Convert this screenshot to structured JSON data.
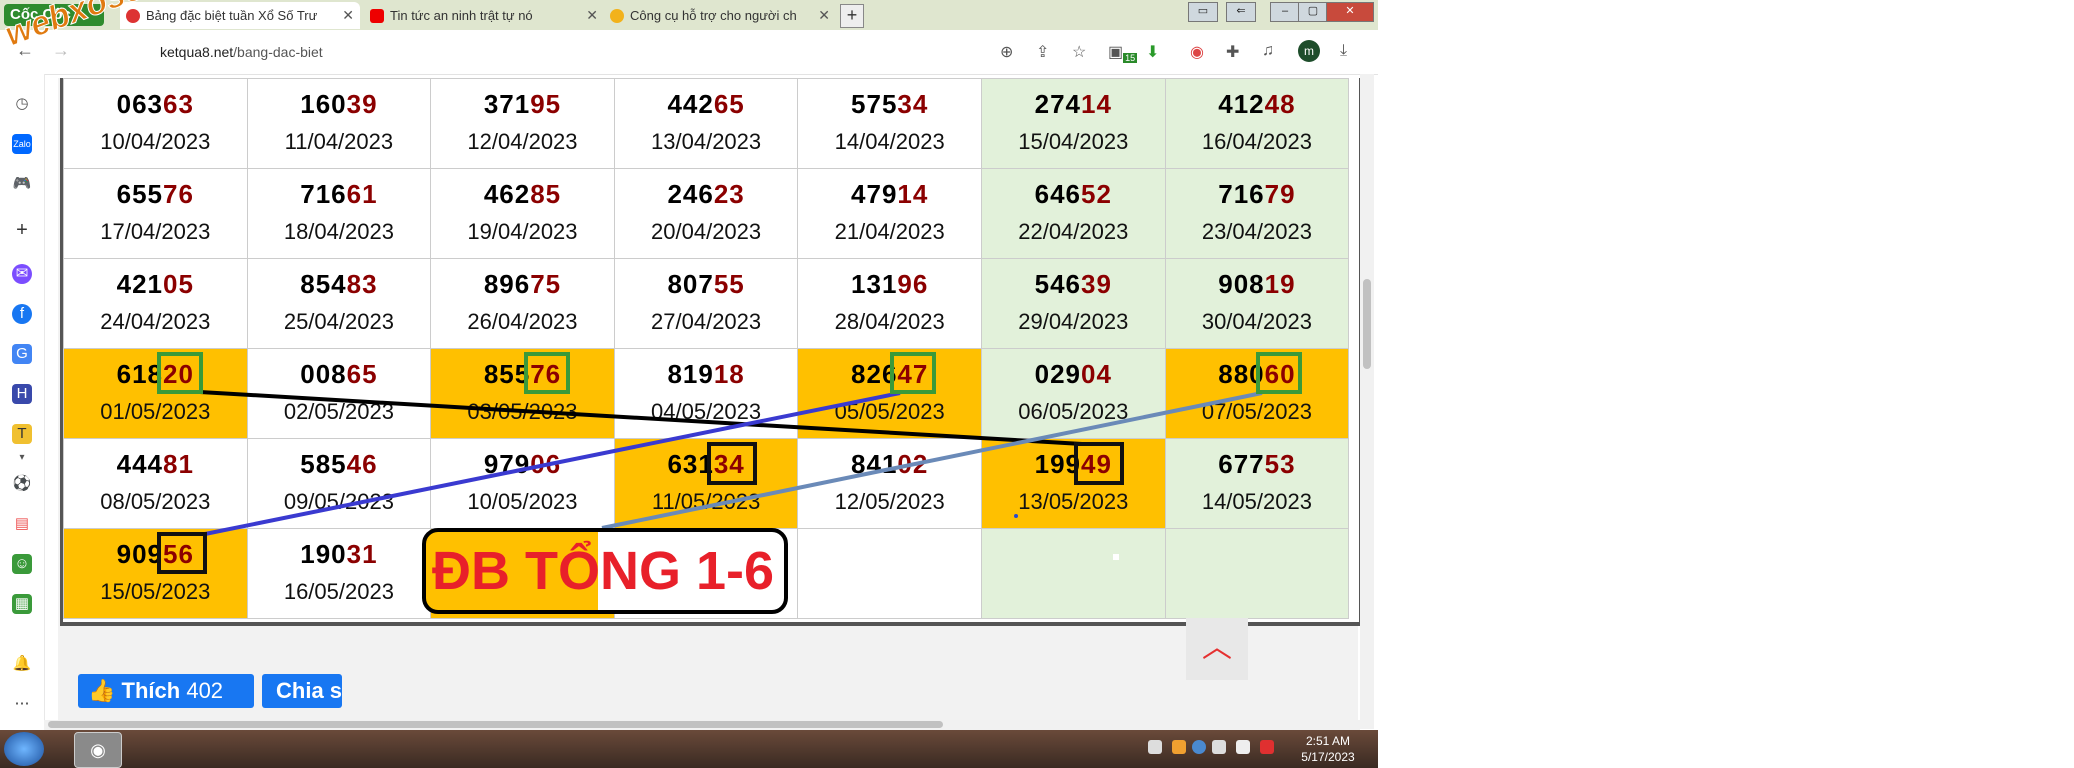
{
  "browser": {
    "brand": "Cốc Cốc",
    "tabs": [
      {
        "label": "Bảng đặc biệt tuần Xổ Số Trư",
        "icon": "coccoc-tab-icon",
        "active": true
      },
      {
        "label": "Tin tức an ninh trật tự nó",
        "icon": "youtube-icon",
        "active": false
      },
      {
        "label": "Công cụ hỗ trợ cho người ch",
        "icon": "xs-icon",
        "active": false
      }
    ],
    "url_host": "ketqua8.net",
    "url_path": "/bang-dac-biet",
    "profile_initial": "m",
    "ext_badge": "15"
  },
  "watermark": "webxoso.net",
  "results": [
    [
      {
        "head": "063",
        "tail": "63",
        "date": "10/04/2023",
        "bg": "white"
      },
      {
        "head": "160",
        "tail": "39",
        "date": "11/04/2023",
        "bg": "white"
      },
      {
        "head": "371",
        "tail": "95",
        "date": "12/04/2023",
        "bg": "white"
      },
      {
        "head": "442",
        "tail": "65",
        "date": "13/04/2023",
        "bg": "white"
      },
      {
        "head": "575",
        "tail": "34",
        "date": "14/04/2023",
        "bg": "white"
      },
      {
        "head": "274",
        "tail": "14",
        "date": "15/04/2023",
        "bg": "green"
      },
      {
        "head": "412",
        "tail": "48",
        "date": "16/04/2023",
        "bg": "green"
      }
    ],
    [
      {
        "head": "655",
        "tail": "76",
        "date": "17/04/2023",
        "bg": "white"
      },
      {
        "head": "716",
        "tail": "61",
        "date": "18/04/2023",
        "bg": "white"
      },
      {
        "head": "462",
        "tail": "85",
        "date": "19/04/2023",
        "bg": "white"
      },
      {
        "head": "246",
        "tail": "23",
        "date": "20/04/2023",
        "bg": "white"
      },
      {
        "head": "479",
        "tail": "14",
        "date": "21/04/2023",
        "bg": "white"
      },
      {
        "head": "646",
        "tail": "52",
        "date": "22/04/2023",
        "bg": "green"
      },
      {
        "head": "716",
        "tail": "79",
        "date": "23/04/2023",
        "bg": "green"
      }
    ],
    [
      {
        "head": "421",
        "tail": "05",
        "date": "24/04/2023",
        "bg": "white"
      },
      {
        "head": "854",
        "tail": "83",
        "date": "25/04/2023",
        "bg": "white"
      },
      {
        "head": "896",
        "tail": "75",
        "date": "26/04/2023",
        "bg": "white"
      },
      {
        "head": "807",
        "tail": "55",
        "date": "27/04/2023",
        "bg": "white"
      },
      {
        "head": "131",
        "tail": "96",
        "date": "28/04/2023",
        "bg": "white"
      },
      {
        "head": "546",
        "tail": "39",
        "date": "29/04/2023",
        "bg": "green"
      },
      {
        "head": "908",
        "tail": "19",
        "date": "30/04/2023",
        "bg": "green"
      }
    ],
    [
      {
        "head": "618",
        "tail": "20",
        "date": "01/05/2023",
        "bg": "yellow"
      },
      {
        "head": "008",
        "tail": "65",
        "date": "02/05/2023",
        "bg": "white"
      },
      {
        "head": "855",
        "tail": "76",
        "date": "03/05/2023",
        "bg": "yellow"
      },
      {
        "head": "819",
        "tail": "18",
        "date": "04/05/2023",
        "bg": "white"
      },
      {
        "head": "826",
        "tail": "47",
        "date": "05/05/2023",
        "bg": "yellow"
      },
      {
        "head": "029",
        "tail": "04",
        "date": "06/05/2023",
        "bg": "green"
      },
      {
        "head": "880",
        "tail": "60",
        "date": "07/05/2023",
        "bg": "yellow"
      }
    ],
    [
      {
        "head": "444",
        "tail": "81",
        "date": "08/05/2023",
        "bg": "white"
      },
      {
        "head": "585",
        "tail": "46",
        "date": "09/05/2023",
        "bg": "white"
      },
      {
        "head": "979",
        "tail": "06",
        "date": "10/05/2023",
        "bg": "white"
      },
      {
        "head": "631",
        "tail": "34",
        "date": "11/05/2023",
        "bg": "yellow"
      },
      {
        "head": "841",
        "tail": "02",
        "date": "12/05/2023",
        "bg": "white"
      },
      {
        "head": "199",
        "tail": "49",
        "date": "13/05/2023",
        "bg": "yellow"
      },
      {
        "head": "677",
        "tail": "53",
        "date": "14/05/2023",
        "bg": "green"
      }
    ],
    [
      {
        "head": "909",
        "tail": "56",
        "date": "15/05/2023",
        "bg": "yellow"
      },
      {
        "head": "190",
        "tail": "31",
        "date": "16/05/2023",
        "bg": "white"
      },
      {
        "head": "",
        "tail": "",
        "date": "",
        "bg": "yellow"
      },
      {
        "head": "",
        "tail": "",
        "date": "",
        "bg": "white"
      },
      {
        "head": "",
        "tail": "",
        "date": "",
        "bg": "white"
      },
      {
        "head": "",
        "tail": "",
        "date": "",
        "bg": "green"
      },
      {
        "head": "",
        "tail": "",
        "date": "",
        "bg": "green"
      }
    ]
  ],
  "banner": "ĐB TỔNG 1-6",
  "social": {
    "like_label": "Thích",
    "like_count": "402",
    "share_label": "Chia s"
  },
  "taskbar": {
    "time": "2:51 AM",
    "date": "5/17/2023"
  },
  "colors": {
    "highlight": "#ffc000",
    "weekend": "#e2f1da",
    "tail": "#8b0000",
    "banner_text": "#e8202a"
  }
}
